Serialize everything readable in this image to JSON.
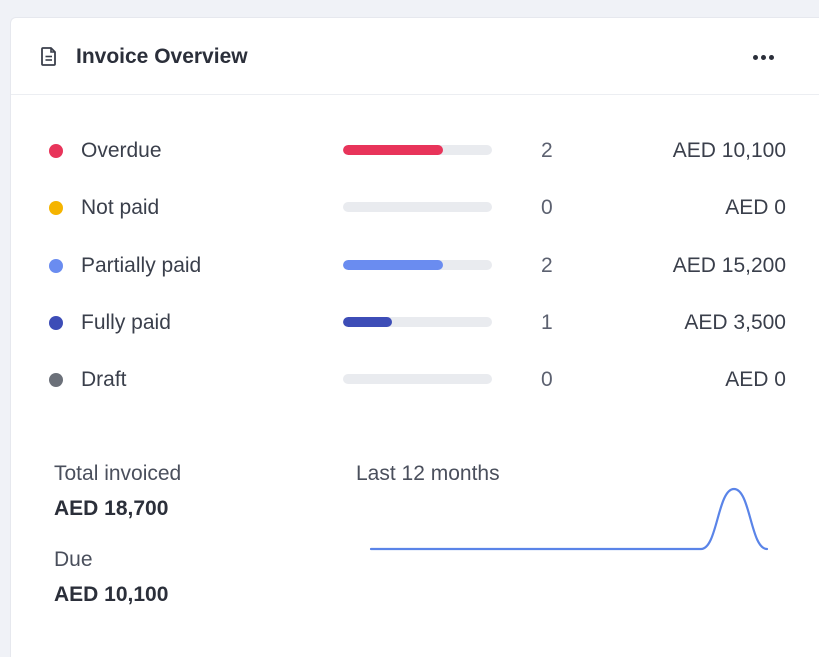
{
  "card": {
    "title": "Invoice Overview",
    "icon": "document-icon",
    "more_icon": "more-horizontal-icon"
  },
  "statuses": [
    {
      "label": "Overdue",
      "color": "#e8345a",
      "count": "2",
      "amount": "AED 10,100",
      "bar_fraction": 0.67
    },
    {
      "label": "Not paid",
      "color": "#f5b400",
      "count": "0",
      "amount": "AED 0",
      "bar_fraction": 0
    },
    {
      "label": "Partially paid",
      "color": "#6a8cf0",
      "count": "2",
      "amount": "AED 15,200",
      "bar_fraction": 0.67
    },
    {
      "label": "Fully paid",
      "color": "#3d4db7",
      "count": "1",
      "amount": "AED 3,500",
      "bar_fraction": 0.33
    },
    {
      "label": "Draft",
      "color": "#6b7079",
      "count": "0",
      "amount": "AED 0",
      "bar_fraction": 0
    }
  ],
  "summary": {
    "total_label": "Total invoiced",
    "total_value": "AED 18,700",
    "due_label": "Due",
    "due_value": "AED 10,100",
    "period_label": "Last 12 months"
  },
  "trend": {
    "color": "#5a84e8",
    "values": [
      0,
      0,
      0,
      0,
      0,
      0,
      0,
      0,
      0,
      0,
      0,
      18700,
      0
    ]
  }
}
